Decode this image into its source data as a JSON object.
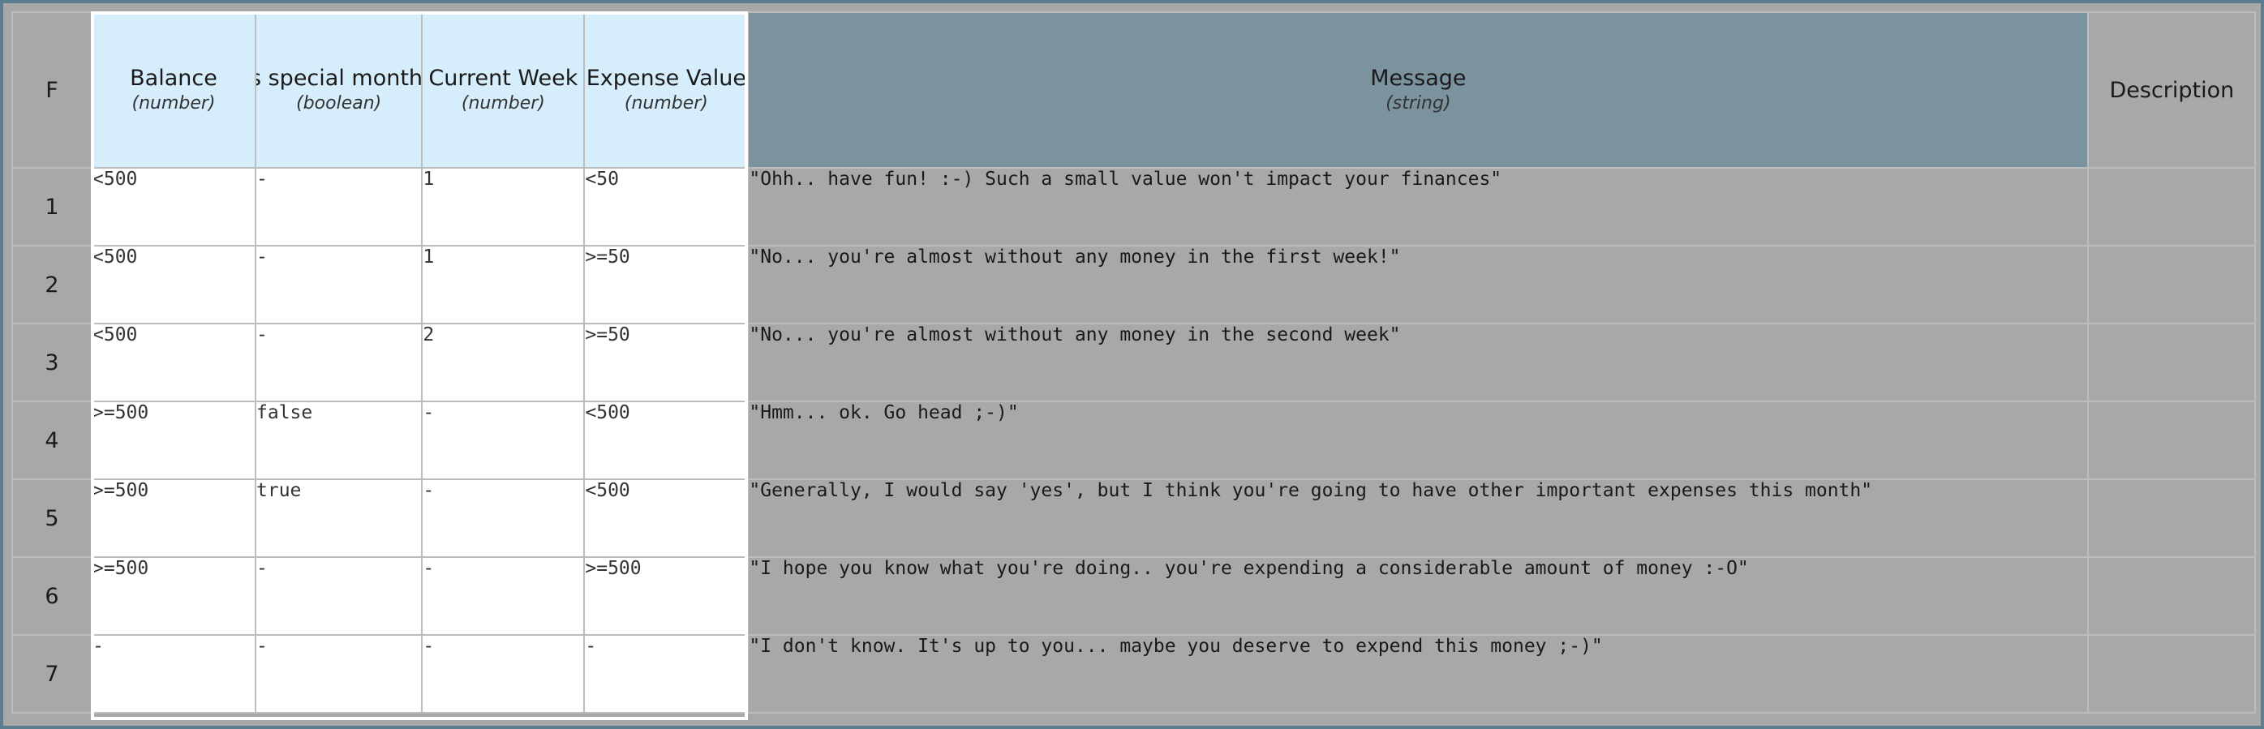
{
  "table": {
    "hit_policy": "F",
    "inputs": [
      {
        "name": "Balance",
        "type": "(number)"
      },
      {
        "name": "Is special month?",
        "type": "(boolean)"
      },
      {
        "name": "Current Week",
        "type": "(number)"
      },
      {
        "name": "Expense Value",
        "type": "(number)"
      }
    ],
    "output": {
      "name": "Message",
      "type": "(string)"
    },
    "annotation": {
      "name": "Description"
    },
    "rows": [
      {
        "index": "1",
        "balance": "<500",
        "special_month": "-",
        "current_week": "1",
        "expense_value": "<50",
        "message": "\"Ohh.. have fun! :-) Such a small value won't impact your finances\"",
        "description": ""
      },
      {
        "index": "2",
        "balance": "<500",
        "special_month": "-",
        "current_week": "1",
        "expense_value": ">=50",
        "message": "\"No... you're almost without any money in the first week!\"",
        "description": ""
      },
      {
        "index": "3",
        "balance": "<500",
        "special_month": "-",
        "current_week": "2",
        "expense_value": ">=50",
        "message": "\"No... you're almost without any money in the second week\"",
        "description": ""
      },
      {
        "index": "4",
        "balance": ">=500",
        "special_month": "false",
        "current_week": "-",
        "expense_value": "<500",
        "message": "\"Hmm... ok. Go head ;-)\"",
        "description": ""
      },
      {
        "index": "5",
        "balance": ">=500",
        "special_month": "true",
        "current_week": "-",
        "expense_value": "<500",
        "message": "\"Generally, I would say 'yes', but I think you're going to have other important expenses this month\"",
        "description": ""
      },
      {
        "index": "6",
        "balance": ">=500",
        "special_month": "-",
        "current_week": "-",
        "expense_value": ">=500",
        "message": "\"I hope you know what you're doing.. you're expending a considerable amount of money :-O\"",
        "description": ""
      },
      {
        "index": "7",
        "balance": "-",
        "special_month": "-",
        "current_week": "-",
        "expense_value": "-",
        "message": "\"I don't know. It's up to you... maybe you deserve to expend this money ;-)\"",
        "description": ""
      }
    ]
  },
  "colors": {
    "input_header": "#d6edfb",
    "output_header": "#7a939f",
    "frame_border": "#5a7d90",
    "gray_cells": "#a8a8a8"
  }
}
